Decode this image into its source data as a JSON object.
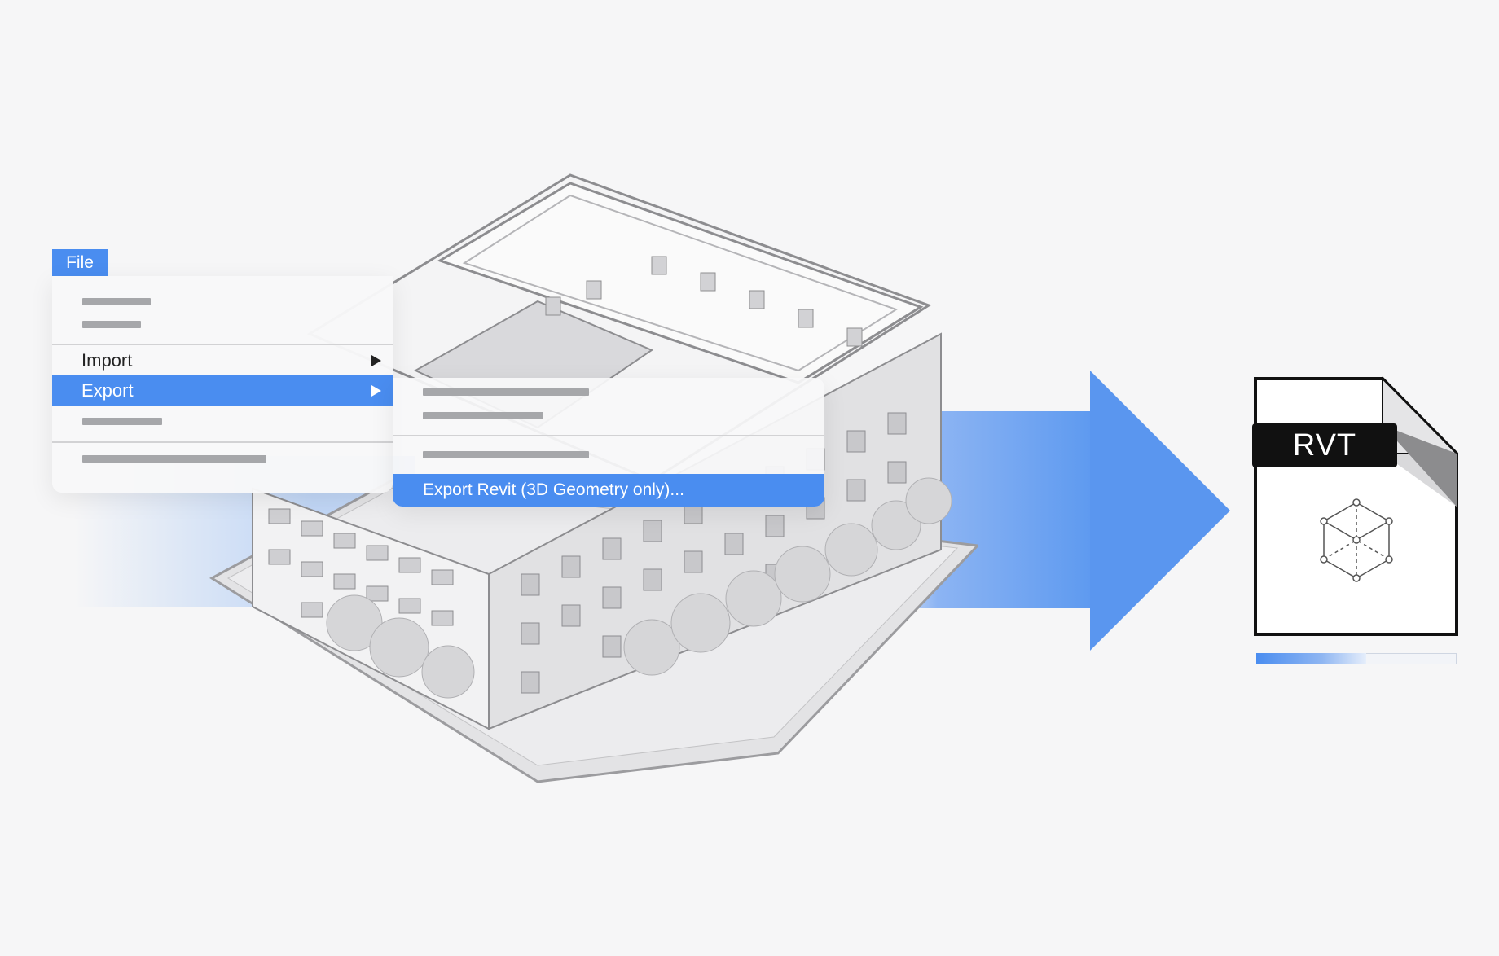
{
  "menu": {
    "file_label": "File",
    "items": [
      {
        "label": "Import",
        "has_submenu": true,
        "active": false
      },
      {
        "label": "Export",
        "has_submenu": true,
        "active": true
      }
    ]
  },
  "submenu": {
    "active_item": "Export Revit (3D Geometry only)..."
  },
  "file_icon": {
    "format_label": "RVT",
    "icon": "cube-icon"
  },
  "progress": {
    "value": 0.55
  },
  "colors": {
    "accent": "#4a8df0",
    "background": "#f6f6f7"
  }
}
